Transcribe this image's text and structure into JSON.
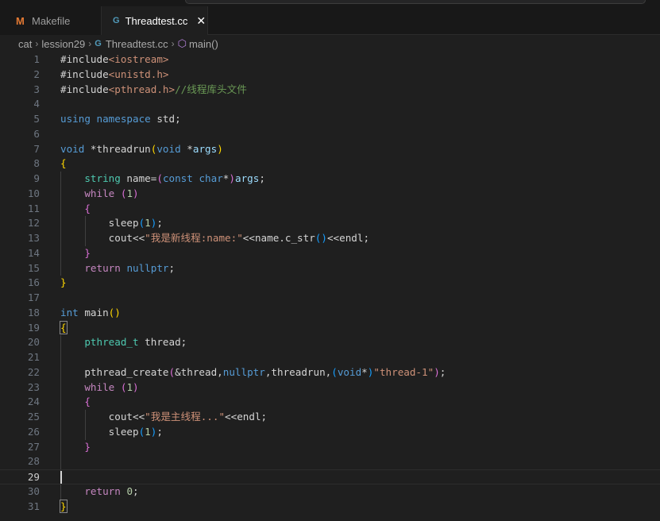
{
  "tabs": [
    {
      "icon": "M",
      "label": "Makefile",
      "active": false
    },
    {
      "icon": "G",
      "label": "Threadtest.cc",
      "close": "✕",
      "active": true
    }
  ],
  "breadcrumb": {
    "folder1": "cat",
    "folder2": "lession29",
    "file": "Threadtest.cc",
    "symbol": "main()"
  },
  "editor": {
    "current_line": 29,
    "lines": [
      {
        "n": "1",
        "t": [
          [
            "t-def",
            "#include"
          ],
          [
            "t-str",
            "<iostream>"
          ]
        ]
      },
      {
        "n": "2",
        "t": [
          [
            "t-def",
            "#include"
          ],
          [
            "t-str",
            "<unistd.h>"
          ]
        ]
      },
      {
        "n": "3",
        "t": [
          [
            "t-def",
            "#include"
          ],
          [
            "t-str",
            "<pthread.h>"
          ],
          [
            "t-cmt",
            "//线程库头文件"
          ]
        ]
      },
      {
        "n": "4",
        "t": []
      },
      {
        "n": "5",
        "t": [
          [
            "t-kw",
            "using"
          ],
          [
            "t-def",
            " "
          ],
          [
            "t-kw",
            "namespace"
          ],
          [
            "t-def",
            " std;"
          ]
        ]
      },
      {
        "n": "6",
        "t": []
      },
      {
        "n": "7",
        "t": [
          [
            "t-kw",
            "void"
          ],
          [
            "t-def",
            " *threadrun"
          ],
          [
            "t-b1",
            "("
          ],
          [
            "t-kw",
            "void"
          ],
          [
            "t-def",
            " *"
          ],
          [
            "t-par",
            "args"
          ],
          [
            "t-b1",
            ")"
          ]
        ]
      },
      {
        "n": "8",
        "t": [
          [
            "t-b1",
            "{"
          ]
        ]
      },
      {
        "n": "9",
        "t": [
          [
            "t-def",
            "    "
          ],
          [
            "t-type",
            "string"
          ],
          [
            "t-def",
            " name="
          ],
          [
            "t-b2",
            "("
          ],
          [
            "t-kw",
            "const"
          ],
          [
            "t-def",
            " "
          ],
          [
            "t-kw",
            "char"
          ],
          [
            "t-def",
            "*"
          ],
          [
            "t-b2",
            ")"
          ],
          [
            "t-par",
            "args"
          ],
          [
            "t-def",
            ";"
          ]
        ]
      },
      {
        "n": "10",
        "t": [
          [
            "t-def",
            "    "
          ],
          [
            "t-ctl",
            "while"
          ],
          [
            "t-def",
            " "
          ],
          [
            "t-b2",
            "("
          ],
          [
            "t-num",
            "1"
          ],
          [
            "t-b2",
            ")"
          ]
        ]
      },
      {
        "n": "11",
        "t": [
          [
            "t-def",
            "    "
          ],
          [
            "t-b2",
            "{"
          ]
        ]
      },
      {
        "n": "12",
        "t": [
          [
            "t-def",
            "        sleep"
          ],
          [
            "t-b3",
            "("
          ],
          [
            "t-num",
            "1"
          ],
          [
            "t-b3",
            ")"
          ],
          [
            "t-def",
            ";"
          ]
        ]
      },
      {
        "n": "13",
        "t": [
          [
            "t-def",
            "        cout<<"
          ],
          [
            "t-str",
            "\"我是新线程:name:\""
          ],
          [
            "t-def",
            "<<name.c_str"
          ],
          [
            "t-b3",
            "()"
          ],
          [
            "t-def",
            "<<endl;"
          ]
        ]
      },
      {
        "n": "14",
        "t": [
          [
            "t-def",
            "    "
          ],
          [
            "t-b2",
            "}"
          ]
        ]
      },
      {
        "n": "15",
        "t": [
          [
            "t-def",
            "    "
          ],
          [
            "t-ctl",
            "return"
          ],
          [
            "t-def",
            " "
          ],
          [
            "t-kw",
            "nullptr"
          ],
          [
            "t-def",
            ";"
          ]
        ]
      },
      {
        "n": "16",
        "t": [
          [
            "t-b1",
            "}"
          ]
        ]
      },
      {
        "n": "17",
        "t": []
      },
      {
        "n": "18",
        "t": [
          [
            "t-kw",
            "int"
          ],
          [
            "t-def",
            " main"
          ],
          [
            "t-b1",
            "()"
          ]
        ]
      },
      {
        "n": "19",
        "t": [
          [
            "t-b1 t-bh",
            "{"
          ]
        ]
      },
      {
        "n": "20",
        "t": [
          [
            "t-def",
            "    "
          ],
          [
            "t-type",
            "pthread_t"
          ],
          [
            "t-def",
            " thread;"
          ]
        ]
      },
      {
        "n": "21",
        "t": []
      },
      {
        "n": "22",
        "t": [
          [
            "t-def",
            "    pthread_create"
          ],
          [
            "t-b2",
            "("
          ],
          [
            "t-def",
            "&thread,"
          ],
          [
            "t-kw",
            "nullptr"
          ],
          [
            "t-def",
            ",threadrun,"
          ],
          [
            "t-b3",
            "("
          ],
          [
            "t-kw",
            "void"
          ],
          [
            "t-def",
            "*"
          ],
          [
            "t-b3",
            ")"
          ],
          [
            "t-str",
            "\"thread-1\""
          ],
          [
            "t-b2",
            ")"
          ],
          [
            "t-def",
            ";"
          ]
        ]
      },
      {
        "n": "23",
        "t": [
          [
            "t-def",
            "    "
          ],
          [
            "t-ctl",
            "while"
          ],
          [
            "t-def",
            " "
          ],
          [
            "t-b2",
            "("
          ],
          [
            "t-num",
            "1"
          ],
          [
            "t-b2",
            ")"
          ]
        ]
      },
      {
        "n": "24",
        "t": [
          [
            "t-def",
            "    "
          ],
          [
            "t-b2",
            "{"
          ]
        ]
      },
      {
        "n": "25",
        "t": [
          [
            "t-def",
            "        cout<<"
          ],
          [
            "t-str",
            "\"我是主线程...\""
          ],
          [
            "t-def",
            "<<endl;"
          ]
        ]
      },
      {
        "n": "26",
        "t": [
          [
            "t-def",
            "        sleep"
          ],
          [
            "t-b3",
            "("
          ],
          [
            "t-num",
            "1"
          ],
          [
            "t-b3",
            ")"
          ],
          [
            "t-def",
            ";"
          ]
        ]
      },
      {
        "n": "27",
        "t": [
          [
            "t-def",
            "    "
          ],
          [
            "t-b2",
            "}"
          ]
        ]
      },
      {
        "n": "28",
        "t": []
      },
      {
        "n": "29",
        "t": []
      },
      {
        "n": "30",
        "t": [
          [
            "t-def",
            "    "
          ],
          [
            "t-ctl",
            "return"
          ],
          [
            "t-def",
            " "
          ],
          [
            "t-num",
            "0"
          ],
          [
            "t-def",
            ";"
          ]
        ]
      },
      {
        "n": "31",
        "t": [
          [
            "t-b1 t-bh",
            "}"
          ]
        ]
      }
    ]
  }
}
